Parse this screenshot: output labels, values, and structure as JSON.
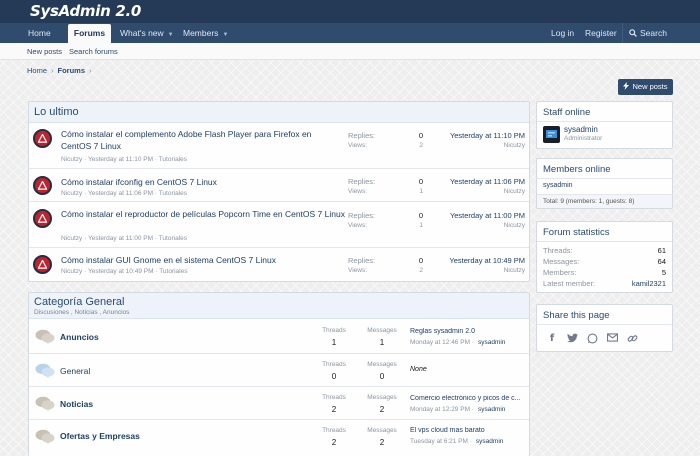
{
  "header": {
    "logo": "SysAdmin 2.0"
  },
  "nav": {
    "tabs": [
      {
        "label": "Home"
      },
      {
        "label": "Forums"
      },
      {
        "label": "What's new"
      },
      {
        "label": "Members"
      }
    ],
    "right": [
      {
        "label": "Log in"
      },
      {
        "label": "Register"
      },
      {
        "label": "Search"
      }
    ]
  },
  "subnav": [
    {
      "label": "New posts"
    },
    {
      "label": "Search forums"
    }
  ],
  "breadcrumb": {
    "home": "Home",
    "current": "Forums"
  },
  "new_posts_button": "New posts",
  "latest": {
    "title": "Lo ultimo",
    "threads": [
      {
        "title": "Cómo instalar el complemento Adobe Flash Player para Firefox en CentOS 7 Linux",
        "author": "Nicutzy",
        "date": "Yesterday at 11:10 PM",
        "forum": "Tutoriales",
        "replies_label": "Replies:",
        "replies": "0",
        "views_label": "Views:",
        "views": "2",
        "last_date": "Yesterday at 11:10 PM",
        "last_user": "Nicutzy"
      },
      {
        "title": "Cómo instalar ifconfig en CentOS 7 Linux",
        "author": "Nicutzy",
        "date": "Yesterday at 11:06 PM",
        "forum": "Tutoriales",
        "replies_label": "Replies:",
        "replies": "0",
        "views_label": "Views:",
        "views": "1",
        "last_date": "Yesterday at 11:06 PM",
        "last_user": "Nicutzy"
      },
      {
        "title": "Cómo instalar el reproductor de películas Popcorn Time en CentOS 7 Linux",
        "author": "Nicutzy",
        "date": "Yesterday at 11:00 PM",
        "forum": "Tutoriales",
        "replies_label": "Replies:",
        "replies": "0",
        "views_label": "Views:",
        "views": "1",
        "last_date": "Yesterday at 11:00 PM",
        "last_user": "Nicutzy"
      },
      {
        "title": "Cómo instalar GUI Gnome en el sistema CentOS 7 Linux",
        "author": "Nicutzy",
        "date": "Yesterday at 10:49 PM",
        "forum": "Tutoriales",
        "replies_label": "Replies:",
        "replies": "0",
        "views_label": "Views:",
        "views": "2",
        "last_date": "Yesterday at 10:49 PM",
        "last_user": "Nicutzy"
      }
    ]
  },
  "category": {
    "title": "Categoría General",
    "desc": "Discusiones , Noticias , Anuncios",
    "forums": [
      {
        "name": "Anuncios",
        "threads_label": "Threads",
        "threads": "1",
        "messages_label": "Messages",
        "messages": "1",
        "last_title": "Reglas sysadmin 2.0",
        "last_date": "Monday at 12:46 PM",
        "last_user": "sysadmin"
      },
      {
        "name": "General",
        "threads_label": "Threads",
        "threads": "0",
        "messages_label": "Messages",
        "messages": "0",
        "last_title": "None",
        "last_date": "",
        "last_user": ""
      },
      {
        "name": "Noticias",
        "threads_label": "Threads",
        "threads": "2",
        "messages_label": "Messages",
        "messages": "2",
        "last_title": "Comercio electrónico y picos de c...",
        "last_date": "Monday at 12:29 PM",
        "last_user": "sysadmin"
      },
      {
        "name": "Ofertas y Empresas",
        "threads_label": "Threads",
        "threads": "2",
        "messages_label": "Messages",
        "messages": "2",
        "last_title": "El vps cloud mas barato",
        "last_date": "Tuesday at 6:21 PM",
        "last_user": "sysadmin"
      }
    ]
  },
  "sidebar": {
    "staff": {
      "title": "Staff online",
      "name": "sysadmin",
      "role": "Administrator"
    },
    "members": {
      "title": "Members online",
      "name": "sysadmin",
      "total": "Total: 9 (members: 1, guests: 8)"
    },
    "stats": {
      "title": "Forum statistics",
      "rows": [
        {
          "k": "Threads:",
          "v": "61"
        },
        {
          "k": "Messages:",
          "v": "64"
        },
        {
          "k": "Members:",
          "v": "5"
        },
        {
          "k": "Latest member:",
          "v": "kamil2321"
        }
      ]
    },
    "share": {
      "title": "Share this page"
    }
  },
  "colors": {
    "header": "#243a56",
    "nav": "#2f4b6e",
    "link": "#1e3f68",
    "avatar_red": "#c8202b"
  }
}
